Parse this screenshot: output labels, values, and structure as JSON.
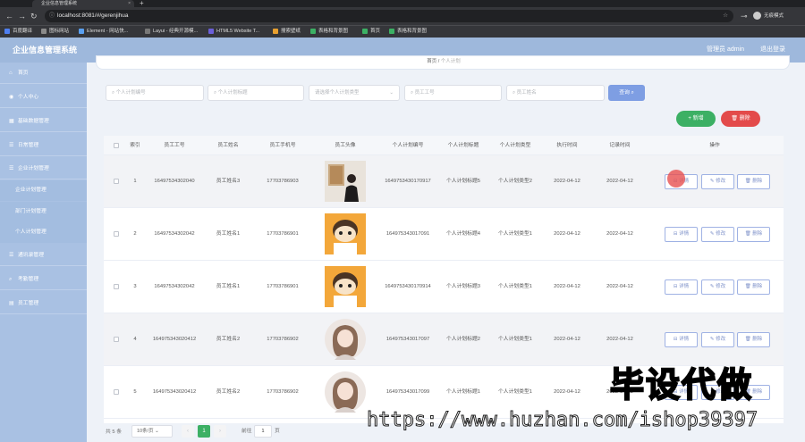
{
  "browser": {
    "tab_title": "企业信息管理系统",
    "url": "localhost:8081/#/gerenjihua",
    "profile": "无痕模式",
    "bookmarks": [
      "百度翻译",
      "图标网站",
      "Element - 网站快...",
      "Layui - 经典开源模...",
      "HTML5 Website T...",
      "搜索壁纸",
      "表格和背景图",
      "首页",
      "表格和背景图"
    ]
  },
  "header": {
    "brand": "企业信息管理系统",
    "user": "管理员 admin",
    "logout": "退出登录"
  },
  "sidebar": {
    "items": [
      {
        "label": "首页",
        "icon": "home-icon"
      },
      {
        "label": "个人中心",
        "icon": "user-icon"
      },
      {
        "label": "基础数据管理",
        "icon": "grid-icon"
      },
      {
        "label": "日常管理",
        "icon": "list-icon"
      },
      {
        "label": "企业计划管理",
        "icon": "list-icon"
      }
    ],
    "subitems": [
      "企业计划管理",
      "部门计划管理",
      "个人计划管理"
    ],
    "items2": [
      {
        "label": "通讯录管理",
        "icon": "list-icon"
      },
      {
        "label": "考勤管理",
        "icon": "search-icon"
      },
      {
        "label": "员工管理",
        "icon": "doc-icon"
      }
    ]
  },
  "breadcrumb": {
    "home": "首页",
    "current": "个人计划"
  },
  "search": {
    "plan_name_placeholder": "个人计划编号",
    "plan_title_placeholder": "个人计划标题",
    "plan_type_placeholder": "请选择个人计划类型",
    "emp_id_placeholder": "员工工号",
    "emp_name_placeholder": "员工姓名",
    "query_label": "查询 ⌕"
  },
  "actions": {
    "add_label": "+ 新增",
    "delete_label": "删除"
  },
  "table": {
    "columns": [
      "索引",
      "员工工号",
      "员工姓名",
      "员工手机号",
      "员工头像",
      "个人计划编号",
      "个人计划标题",
      "个人计划类型",
      "执行时间",
      "记录时间",
      "操作"
    ],
    "row_actions": {
      "detail": "详情",
      "edit": "修改",
      "delete": "删除"
    },
    "rows": [
      {
        "index": "1",
        "emp_id": "16497534302040",
        "emp_name": "员工姓名3",
        "phone": "17703786903",
        "avatar": "photo",
        "plan_no": "1649753430170917",
        "title": "个人计划标题5",
        "type": "个人计划类型2",
        "exec_time": "2022-04-12",
        "record_time": "2022-04-12"
      },
      {
        "index": "2",
        "emp_id": "16497534302042",
        "emp_name": "员工姓名1",
        "phone": "17703786901",
        "avatar": "cartoon",
        "plan_no": "164975343017091",
        "title": "个人计划标题4",
        "type": "个人计划类型1",
        "exec_time": "2022-04-12",
        "record_time": "2022-04-12"
      },
      {
        "index": "3",
        "emp_id": "16497534302042",
        "emp_name": "员工姓名1",
        "phone": "17703786901",
        "avatar": "cartoon",
        "plan_no": "1649753430170914",
        "title": "个人计划标题3",
        "type": "个人计划类型1",
        "exec_time": "2022-04-12",
        "record_time": "2022-04-12"
      },
      {
        "index": "4",
        "emp_id": "164975343020412",
        "emp_name": "员工姓名2",
        "phone": "17703786902",
        "avatar": "girl",
        "plan_no": "164975343017097",
        "title": "个人计划标题2",
        "type": "个人计划类型1",
        "exec_time": "2022-04-12",
        "record_time": "2022-04-12"
      },
      {
        "index": "5",
        "emp_id": "164975343020412",
        "emp_name": "员工姓名2",
        "phone": "17703786902",
        "avatar": "girl",
        "plan_no": "164975343017099",
        "title": "个人计划标题1",
        "type": "个人计划类型1",
        "exec_time": "2022-04-12",
        "record_time": "2022-04-12"
      }
    ]
  },
  "pagination": {
    "total": "共 5 条",
    "page_size": "10条/页",
    "current": "1",
    "goto_label": "前往",
    "goto_value": "1",
    "page_label": "页"
  },
  "watermark": {
    "text": "毕设代做",
    "url": "https://www.huzhan.com/ishop39397"
  },
  "colors": {
    "header": "#9eb8dc",
    "sidebar": "#a9c1e3",
    "add": "#3cb064",
    "delete": "#e34b4b",
    "query": "#7e9ee3"
  }
}
